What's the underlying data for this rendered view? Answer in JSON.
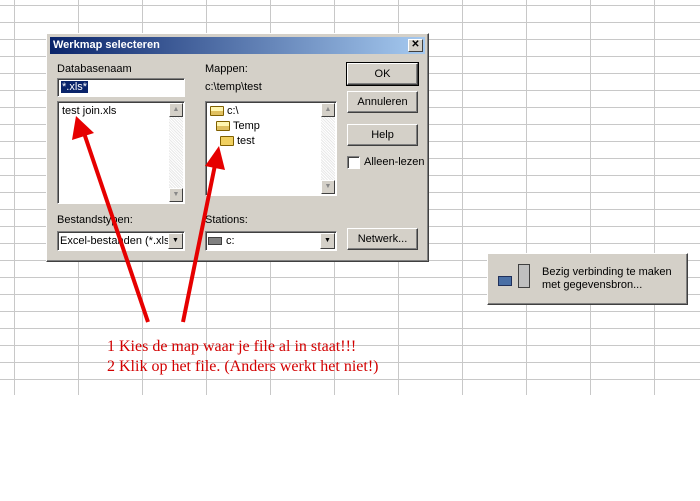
{
  "dialog": {
    "title": "Werkmap selecteren",
    "close_glyph": "✕",
    "database_label": "Databasenaam",
    "database_value": "*.xls*",
    "files": [
      "test join.xls"
    ],
    "folders_label": "Mappen:",
    "current_path": "c:\\temp\\test",
    "folder_tree": [
      {
        "name": "c:\\",
        "icon": "open-folder-icon"
      },
      {
        "name": "Temp",
        "icon": "open-folder-icon"
      },
      {
        "name": "test",
        "icon": "current-folder-icon"
      }
    ],
    "filetypes_label": "Bestandstypen:",
    "filetypes_value": "Excel-bestanden (*.xls*)",
    "stations_label": "Stations:",
    "stations_value": "c:",
    "ok_label": "OK",
    "cancel_label": "Annuleren",
    "help_label": "Help",
    "readonly_label": "Alleen-lezen",
    "network_label": "Netwerk..."
  },
  "popup": {
    "message": "Bezig verbinding te maken met gegevensbron..."
  },
  "annotations": {
    "line1": "1 Kies de map waar je file al in staat!!!",
    "line2": "2 Klik op het file. (Anders werkt het niet!)"
  },
  "colors": {
    "annotation_red": "#d20000",
    "titlebar": "#0a246a",
    "dialog_face": "#d4d0c8"
  }
}
